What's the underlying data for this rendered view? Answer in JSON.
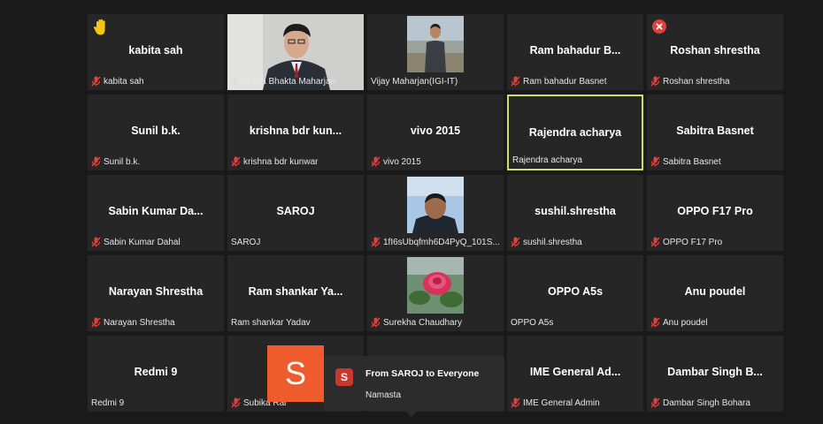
{
  "participants": [
    {
      "title": "kabita sah",
      "name": "kabita sah",
      "muted": true,
      "badge": "hand"
    },
    {
      "name": "Purna Bhakta Maharjan",
      "pinned": true,
      "video": "man-suit"
    },
    {
      "name": "Vijay Maharjan(IGI-IT)",
      "muted": false,
      "video": "man-outdoor"
    },
    {
      "title": "Ram bahadur B...",
      "name": "Ram bahadur Basnet",
      "muted": true
    },
    {
      "title": "Roshan shrestha",
      "name": "Roshan shrestha",
      "muted": true,
      "badge": "x"
    },
    {
      "title": "Sunil b.k.",
      "name": "Sunil b.k.",
      "muted": true
    },
    {
      "title": "krishna bdr kun...",
      "name": "krishna bdr kunwar",
      "muted": true
    },
    {
      "title": "vivo 2015",
      "name": "vivo 2015",
      "muted": true
    },
    {
      "title": "Rajendra acharya",
      "name": "Rajendra acharya",
      "muted": false,
      "active": true
    },
    {
      "title": "Sabitra Basnet",
      "name": "Sabitra Basnet",
      "muted": true
    },
    {
      "title": "Sabin Kumar Da...",
      "name": "Sabin Kumar Dahal",
      "muted": true
    },
    {
      "title": "SAROJ",
      "name": "SAROJ",
      "muted": false
    },
    {
      "name": "1fI6sUbqfmh6D4PyQ_101S...",
      "muted": true,
      "video": "man-sky"
    },
    {
      "title": "sushil.shrestha",
      "name": "sushil.shrestha",
      "muted": true
    },
    {
      "title": "OPPO F17 Pro",
      "name": "OPPO F17 Pro",
      "muted": true
    },
    {
      "title": "Narayan Shrestha",
      "name": "Narayan Shrestha",
      "muted": true
    },
    {
      "title": "Ram shankar Ya...",
      "name": "Ram shankar Yadav",
      "muted": false
    },
    {
      "name": "Surekha Chaudhary",
      "muted": true,
      "video": "rose"
    },
    {
      "title": "OPPO A5s",
      "name": "OPPO A5s",
      "muted": false
    },
    {
      "title": "Anu poudel",
      "name": "Anu poudel",
      "muted": true
    },
    {
      "title": "Redmi 9",
      "name": "Redmi 9",
      "muted": false
    },
    {
      "title": "",
      "name": "Subika Rai",
      "muted": true
    },
    {
      "title": "",
      "name": "",
      "muted": false
    },
    {
      "title": "IME General Ad...",
      "name": "IME General Admin",
      "muted": true
    },
    {
      "title": "Dambar Singh B...",
      "name": "Dambar Singh Bohara",
      "muted": true
    }
  ],
  "chat": {
    "avatar_letter": "S",
    "badge_letter": "S",
    "header": "From SAROJ to Everyone",
    "message": "Namasta"
  },
  "colors": {
    "accent_border": "#c8e06a",
    "mute_red": "#e0413a",
    "chat_avatar": "#ee5b2c"
  }
}
